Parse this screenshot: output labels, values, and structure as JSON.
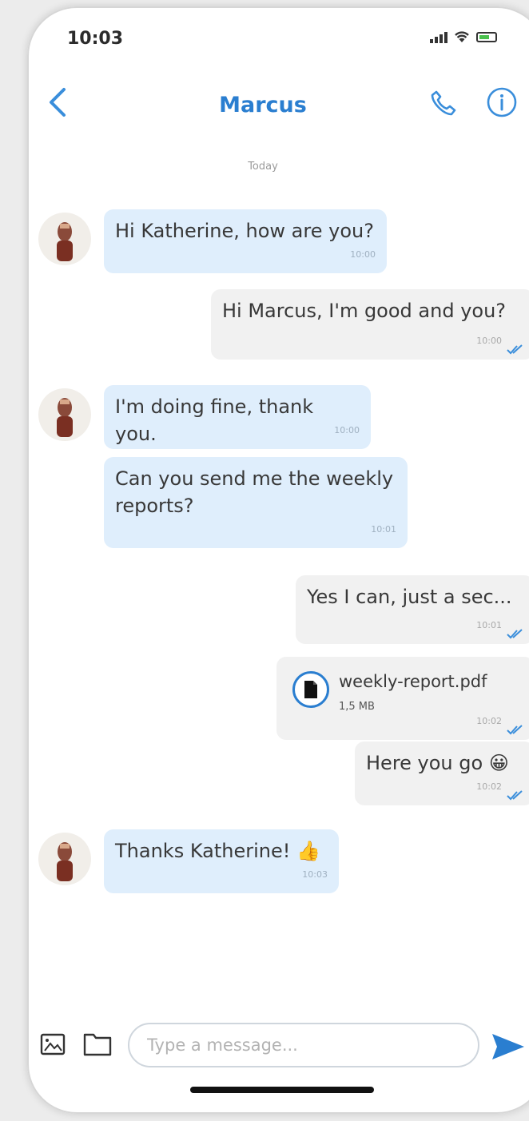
{
  "status_bar": {
    "time": "10:03"
  },
  "header": {
    "contact_name": "Marcus"
  },
  "date_separator": "Today",
  "messages": [
    {
      "direction": "incoming",
      "text": "Hi Katherine, how are you?",
      "time": "10:00"
    },
    {
      "direction": "outgoing",
      "text": "Hi Marcus, I'm good and you?",
      "time": "10:00"
    },
    {
      "direction": "incoming",
      "text": "I'm doing fine, thank you.",
      "time": "10:00"
    },
    {
      "direction": "incoming",
      "text": "Can you send me the weekly reports?",
      "time": "10:01"
    },
    {
      "direction": "outgoing",
      "text": "Yes I can, just a sec...",
      "time": "10:01"
    },
    {
      "direction": "outgoing",
      "type": "file",
      "file_name": "weekly-report.pdf",
      "file_size": "1,5 MB",
      "time": "10:02"
    },
    {
      "direction": "outgoing",
      "text": "Here you go 😀",
      "time": "10:02"
    },
    {
      "direction": "incoming",
      "text": "Thanks Katherine! 👍",
      "time": "10:03"
    }
  ],
  "composer": {
    "placeholder": "Type a message..."
  },
  "colors": {
    "accent": "#2a7ed0",
    "incoming_bubble": "#dfeefc",
    "outgoing_bubble": "#f1f1f1"
  },
  "icons": [
    "back-chevron-icon",
    "phone-icon",
    "info-icon",
    "image-icon",
    "folder-icon",
    "send-icon",
    "double-check-icon",
    "file-icon"
  ]
}
